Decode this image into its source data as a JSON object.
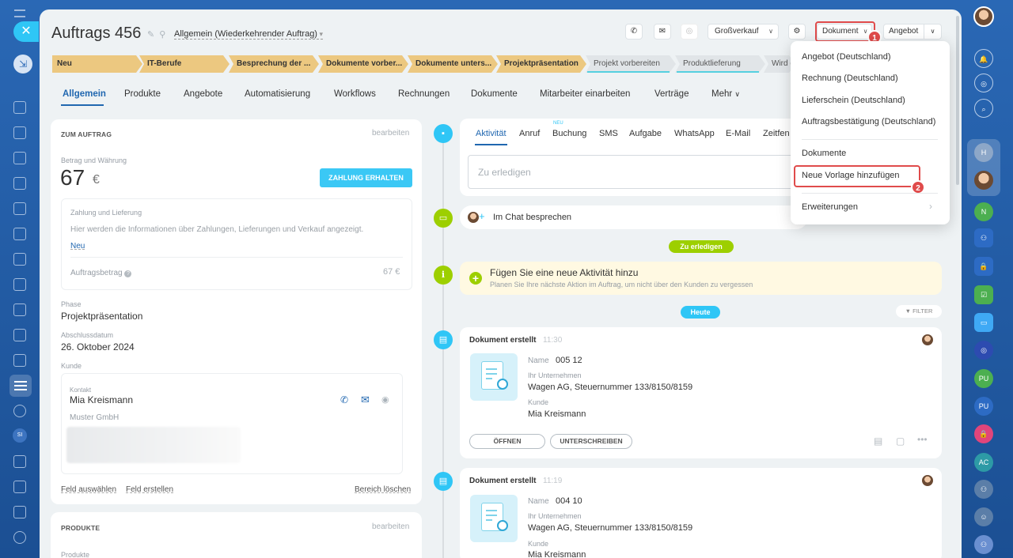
{
  "header": {
    "title": "Auftrags 456",
    "pipeline_name": "Allgemein (Wiederkehrender Auftrag)",
    "segment": "Großverkauf",
    "document_button": "Dokument",
    "offer_button": "Angebot"
  },
  "annotations": {
    "step1": "1",
    "step2": "2"
  },
  "pipeline": [
    {
      "label": "Neu",
      "state": "done"
    },
    {
      "label": "IT-Berufe",
      "state": "done"
    },
    {
      "label": "Besprechung der ...",
      "state": "done"
    },
    {
      "label": "Dokumente vorber...",
      "state": "done"
    },
    {
      "label": "Dokumente unters...",
      "state": "done"
    },
    {
      "label": "Projektpräsentation",
      "state": "done"
    },
    {
      "label": "Projekt vorbereiten",
      "state": "todo"
    },
    {
      "label": "Produktlieferung",
      "state": "todo"
    },
    {
      "label": "Wird g",
      "state": "todo"
    }
  ],
  "tabs": [
    "Allgemein",
    "Produkte",
    "Angebote",
    "Automatisierung",
    "Workflows",
    "Rechnungen",
    "Dokumente",
    "Mitarbeiter einarbeiten",
    "Verträge",
    "Mehr"
  ],
  "order_card": {
    "heading": "ZUM AUFTRAG",
    "edit": "bearbeiten",
    "amount_label": "Betrag und Währung",
    "amount": "67",
    "currency": "€",
    "pay_button": "ZAHLUNG ERHALTEN",
    "payment_title": "Zahlung und Lieferung",
    "payment_info": "Hier werden die Informationen über Zahlungen, Lieferungen und Verkauf angezeigt.",
    "new_link": "Neu",
    "order_amount_label": "Auftragsbetrag",
    "order_amount": "67 €",
    "phase_label": "Phase",
    "phase": "Projektpräsentation",
    "close_date_label": "Abschlussdatum",
    "close_date": "26. Oktober 2024",
    "customer_label": "Kunde",
    "contact_label": "Kontakt",
    "contact_name": "Mia Kreismann",
    "company": "Muster GmbH",
    "select_field": "Feld auswählen",
    "create_field": "Feld erstellen",
    "clear_area": "Bereich löschen"
  },
  "products_card": {
    "heading": "PRODUKTE",
    "edit": "bearbeiten",
    "label": "Produkte"
  },
  "activity": {
    "tabs": [
      "Aktivität",
      "Anruf",
      "Buchung",
      "SMS",
      "Aufgabe",
      "WhatsApp",
      "E-Mail",
      "Zeitfen"
    ],
    "new_badge": "NEU",
    "todo_placeholder": "Zu erledigen",
    "chat": "Im Chat besprechen",
    "todo_pill": "Zu erledigen",
    "add_title": "Fügen Sie eine neue Aktivität hinzu",
    "add_text": "Planen Sie Ihre nächste Aktion im Auftrag, um nicht über den Kunden zu vergessen",
    "today_pill": "Heute",
    "filter": "FILTER"
  },
  "documents": [
    {
      "title": "Dokument erstellt",
      "time": "11:30",
      "name_label": "Name",
      "name": "005 12",
      "company_label": "Ihr Unternehmen",
      "company": "Wagen AG, Steuernummer 133/8150/8159",
      "client_label": "Kunde",
      "client": "Mia Kreismann",
      "open": "ÖFFNEN",
      "sign": "UNTERSCHREIBEN"
    },
    {
      "title": "Dokument erstellt",
      "time": "11:19",
      "name_label": "Name",
      "name": "004 10",
      "company_label": "Ihr Unternehmen",
      "company": "Wagen AG, Steuernummer 133/8150/8159",
      "client_label": "Kunde",
      "client": "Mia Kreismann"
    }
  ],
  "menu": {
    "items": [
      "Angebot (Deutschland)",
      "Rechnung (Deutschland)",
      "Lieferschein (Deutschland)",
      "Auftragsbestätigung (Deutschland)"
    ],
    "documents": "Dokumente",
    "add_template": "Neue Vorlage hinzufügen",
    "extensions": "Erweiterungen"
  },
  "right_rail": [
    "H",
    "N",
    "PU",
    "PU",
    "AC"
  ],
  "left_rail": {
    "si": "SI"
  }
}
